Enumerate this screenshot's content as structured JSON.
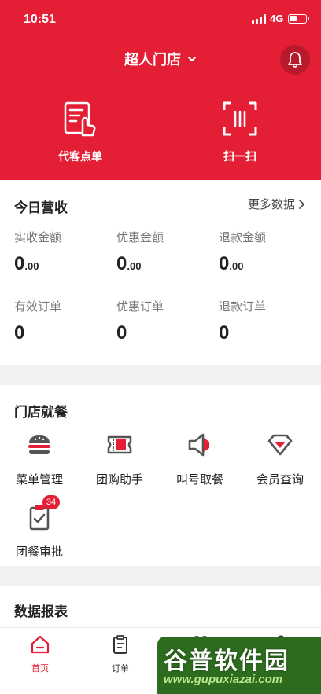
{
  "status_bar": {
    "time": "10:51",
    "network": "4G"
  },
  "header": {
    "store_name": "超人门店",
    "actions": [
      {
        "label": "代客点单",
        "icon": "order-for-customer-icon"
      },
      {
        "label": "扫一扫",
        "icon": "scan-icon"
      }
    ]
  },
  "revenue": {
    "title": "今日营收",
    "more_label": "更多数据",
    "metrics": [
      {
        "label": "实收金额",
        "int": "0",
        "dec": ".00"
      },
      {
        "label": "优惠金额",
        "int": "0",
        "dec": ".00"
      },
      {
        "label": "退款金额",
        "int": "0",
        "dec": ".00"
      },
      {
        "label": "有效订单",
        "value": "0"
      },
      {
        "label": "优惠订单",
        "value": "0"
      },
      {
        "label": "退款订单",
        "value": "0"
      }
    ]
  },
  "store_dining": {
    "title": "门店就餐",
    "features": [
      {
        "label": "菜单管理",
        "icon": "burger-icon"
      },
      {
        "label": "团购助手",
        "icon": "ticket-icon"
      },
      {
        "label": "叫号取餐",
        "icon": "speaker-icon"
      },
      {
        "label": "会员查询",
        "icon": "diamond-icon"
      },
      {
        "label": "团餐审批",
        "icon": "clipboard-check-icon",
        "badge": "34"
      }
    ]
  },
  "data_reports": {
    "title": "数据报表"
  },
  "tabbar": {
    "tabs": [
      {
        "label": "首页",
        "active": true
      },
      {
        "label": "订单",
        "active": false
      }
    ]
  },
  "watermark": {
    "text": "谷普软件园",
    "url": "www.gupuxiazai.com"
  },
  "colors": {
    "brand_red": "#e31e35",
    "dark_red": "#b91a2b"
  }
}
